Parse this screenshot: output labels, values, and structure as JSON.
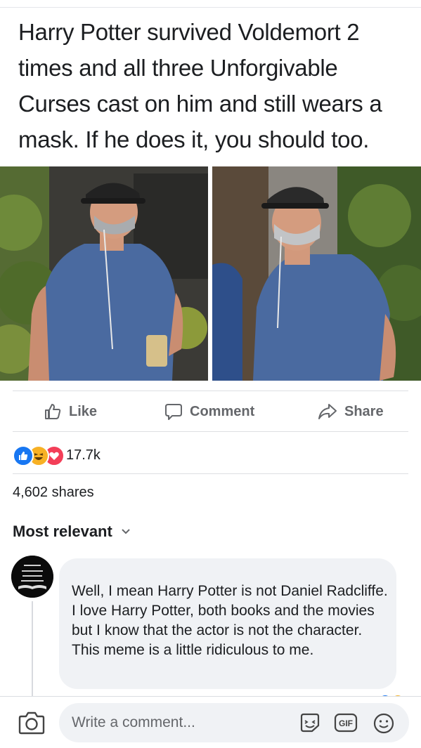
{
  "post": {
    "text": "Harry Potter survived Voldemort 2 times and all three Unforgivable Curses cast on him and still wears a mask. If he does it, you should too."
  },
  "actions": {
    "like_label": "Like",
    "comment_label": "Comment",
    "share_label": "Share"
  },
  "reactions": {
    "count": "17.7k",
    "icons": [
      "like-reaction",
      "haha-reaction",
      "love-reaction"
    ],
    "colors": {
      "like": "#1877f2",
      "haha": "#f7b125",
      "love": "#f33e58"
    }
  },
  "shares": {
    "label": "4,602 shares"
  },
  "comments": {
    "sort_label": "Most relevant",
    "items": [
      {
        "avatar_text": "JUST ONE MORE CHAPTER",
        "text": "Well, I mean Harry Potter is not Daniel Radcliffe. I love Harry Potter, both books and the movies but I know that the actor is not the character. This meme is a little ridiculous to me."
      }
    ]
  },
  "composer": {
    "placeholder": "Write a comment...",
    "icons": [
      "camera-icon",
      "sticker-icon",
      "gif-icon",
      "emoji-icon"
    ]
  },
  "colors": {
    "text": "#1c1e21",
    "secondary": "#65676b",
    "bubble": "#f0f2f5",
    "shirt": "#4a6aa0"
  }
}
